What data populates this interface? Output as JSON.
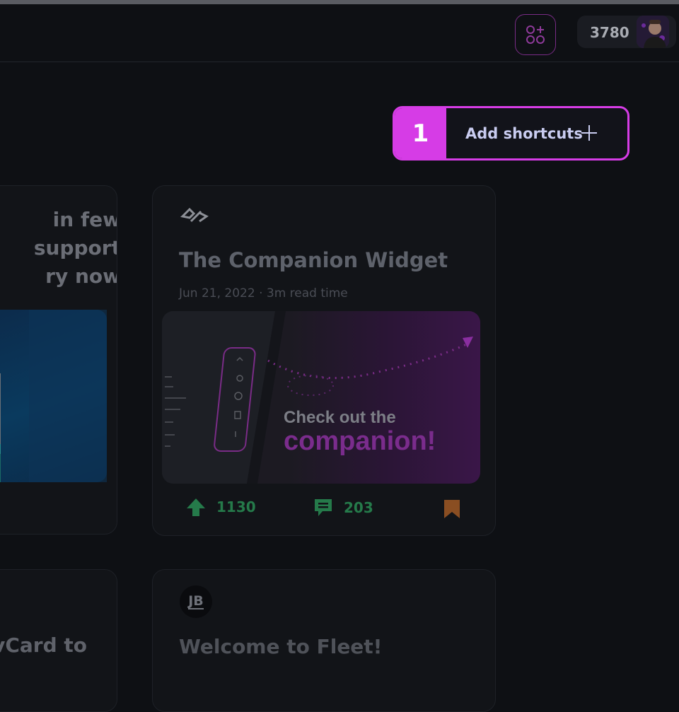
{
  "header": {
    "points": "3780"
  },
  "onboarding": {
    "step_number": "1",
    "add_shortcuts_label": "Add shortcuts"
  },
  "feed": {
    "left_card": {
      "title": "in few\nsupport\nry now"
    },
    "left_card_2": {
      "title": "vCard to"
    },
    "main_card": {
      "title": "The Companion Widget",
      "meta": "Jun 21, 2022 · 3m read time",
      "image_text_1": "Check out the",
      "image_text_2": "companion!",
      "upvotes": "1130",
      "comments": "203"
    },
    "main_card_2": {
      "source_initials": "JB",
      "title": "Welcome to Fleet!"
    }
  },
  "colors": {
    "accent": "#d63ce6",
    "upvote": "#257a4a",
    "bookmark": "#c06a2a"
  }
}
